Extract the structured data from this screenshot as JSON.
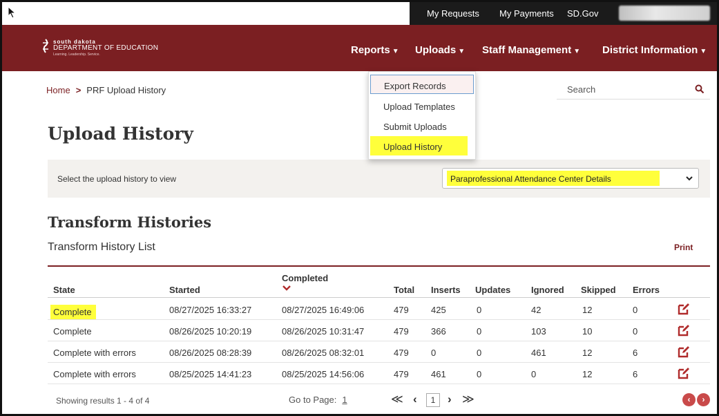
{
  "utilbar": {
    "links": [
      "My Requests",
      "My Payments",
      "SD.Gov"
    ]
  },
  "logo": {
    "line1": "south dakota",
    "line2": "DEPARTMENT OF EDUCATION",
    "line3": "Learning. Leadership. Service."
  },
  "nav": {
    "items": [
      "Reports",
      "Uploads",
      "Staff Management",
      "District Information"
    ]
  },
  "breadcrumb": {
    "home": "Home",
    "current": "PRF Upload History"
  },
  "search": {
    "placeholder": "Search"
  },
  "page_title": "Upload History",
  "selector": {
    "label": "Select the upload history to view",
    "selected": "Paraprofessional Attendance Center Details"
  },
  "section_title": "Transform Histories",
  "list_title": "Transform History List",
  "print_label": "Print",
  "table": {
    "headers": [
      "State",
      "Started",
      "Completed",
      "Total",
      "Inserts",
      "Updates",
      "Ignored",
      "Skipped",
      "Errors"
    ],
    "rows": [
      [
        "Complete",
        "08/27/2025 16:33:27",
        "08/27/2025 16:49:06",
        "479",
        "425",
        "0",
        "42",
        "12",
        "0"
      ],
      [
        "Complete",
        "08/26/2025 10:20:19",
        "08/26/2025 10:31:47",
        "479",
        "366",
        "0",
        "103",
        "10",
        "0"
      ],
      [
        "Complete with errors",
        "08/26/2025 08:28:39",
        "08/26/2025 08:32:01",
        "479",
        "0",
        "0",
        "461",
        "12",
        "6"
      ],
      [
        "Complete with errors",
        "08/25/2025 14:41:23",
        "08/25/2025 14:56:06",
        "479",
        "461",
        "0",
        "0",
        "12",
        "6"
      ]
    ]
  },
  "footer": {
    "showing": "Showing results 1 - 4 of 4",
    "goto_label": "Go to Page:",
    "goto_page": "1",
    "current_page": "1"
  },
  "dropdown": {
    "items": [
      "Export Records",
      "Upload Templates",
      "Submit Uploads",
      "Upload History"
    ]
  },
  "colors": {
    "brand": "#7b1f22",
    "highlight": "#ffff3b",
    "util_bar": "#1b1b1b",
    "pager_circle": "#c94a4a"
  },
  "icons": [
    "cursor-arrow-icon",
    "search-icon",
    "chevron-down-icon",
    "sort-chevron-icon",
    "edit-icon",
    "first-page-icon",
    "prev-page-icon",
    "next-page-icon",
    "last-page-icon",
    "prev-circle-icon",
    "next-circle-icon"
  ]
}
